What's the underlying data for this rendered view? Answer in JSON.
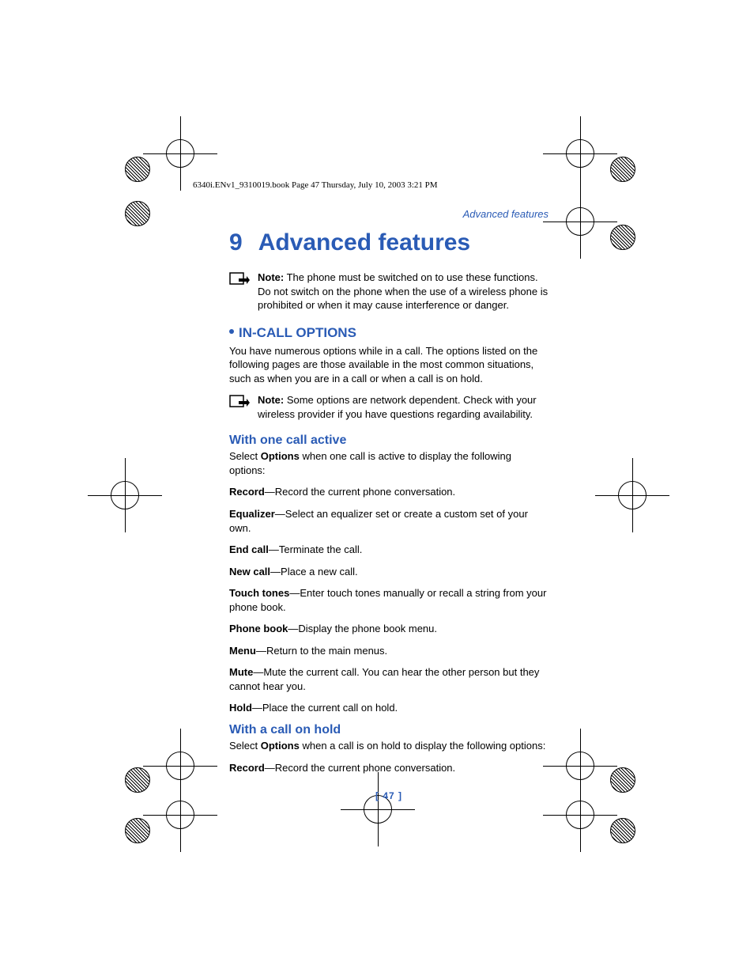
{
  "header_line": "6340i.ENv1_9310019.book  Page 47  Thursday, July 10, 2003  3:21 PM",
  "running_header": "Advanced features",
  "chapter": {
    "number": "9",
    "title": "Advanced features"
  },
  "note1": {
    "label": "Note:",
    "text": " The phone must be switched on to use these functions. Do not switch on the phone when the use of a wireless phone is prohibited or when it may cause interference or danger."
  },
  "section1": {
    "title": "IN-CALL OPTIONS",
    "intro": "You have numerous options while in a call. The options listed on the following pages are those available in the most common situations, such as when you are in a call or when a call is on hold."
  },
  "note2": {
    "label": "Note:",
    "text": " Some options are network dependent. Check with your wireless provider if you have questions regarding availability."
  },
  "sub1": {
    "title": "With one call active",
    "lead_pre": "Select ",
    "lead_bold": "Options",
    "lead_post": " when one call is active to display the following options:",
    "items": [
      {
        "name": "Record",
        "desc": "—Record the current phone conversation."
      },
      {
        "name": "Equalizer",
        "desc": "—Select an equalizer set or create a custom set of your own."
      },
      {
        "name": "End call",
        "desc": "—Terminate the call."
      },
      {
        "name": "New call",
        "desc": "—Place a new call."
      },
      {
        "name": "Touch tones",
        "desc": "—Enter touch tones manually or recall a string from your phone book."
      },
      {
        "name": "Phone book",
        "desc": "—Display the phone book menu."
      },
      {
        "name": "Menu",
        "desc": "—Return to the main menus."
      },
      {
        "name": "Mute",
        "desc": "—Mute the current call. You can hear the other person but they cannot hear you."
      },
      {
        "name": "Hold",
        "desc": "—Place the current call on hold."
      }
    ]
  },
  "sub2": {
    "title": "With a call on hold",
    "lead_pre": "Select ",
    "lead_bold": "Options",
    "lead_post": " when a call is on hold to display the following options:",
    "items": [
      {
        "name": "Record",
        "desc": "—Record the current phone conversation."
      }
    ]
  },
  "page_number": "[ 47 ]"
}
